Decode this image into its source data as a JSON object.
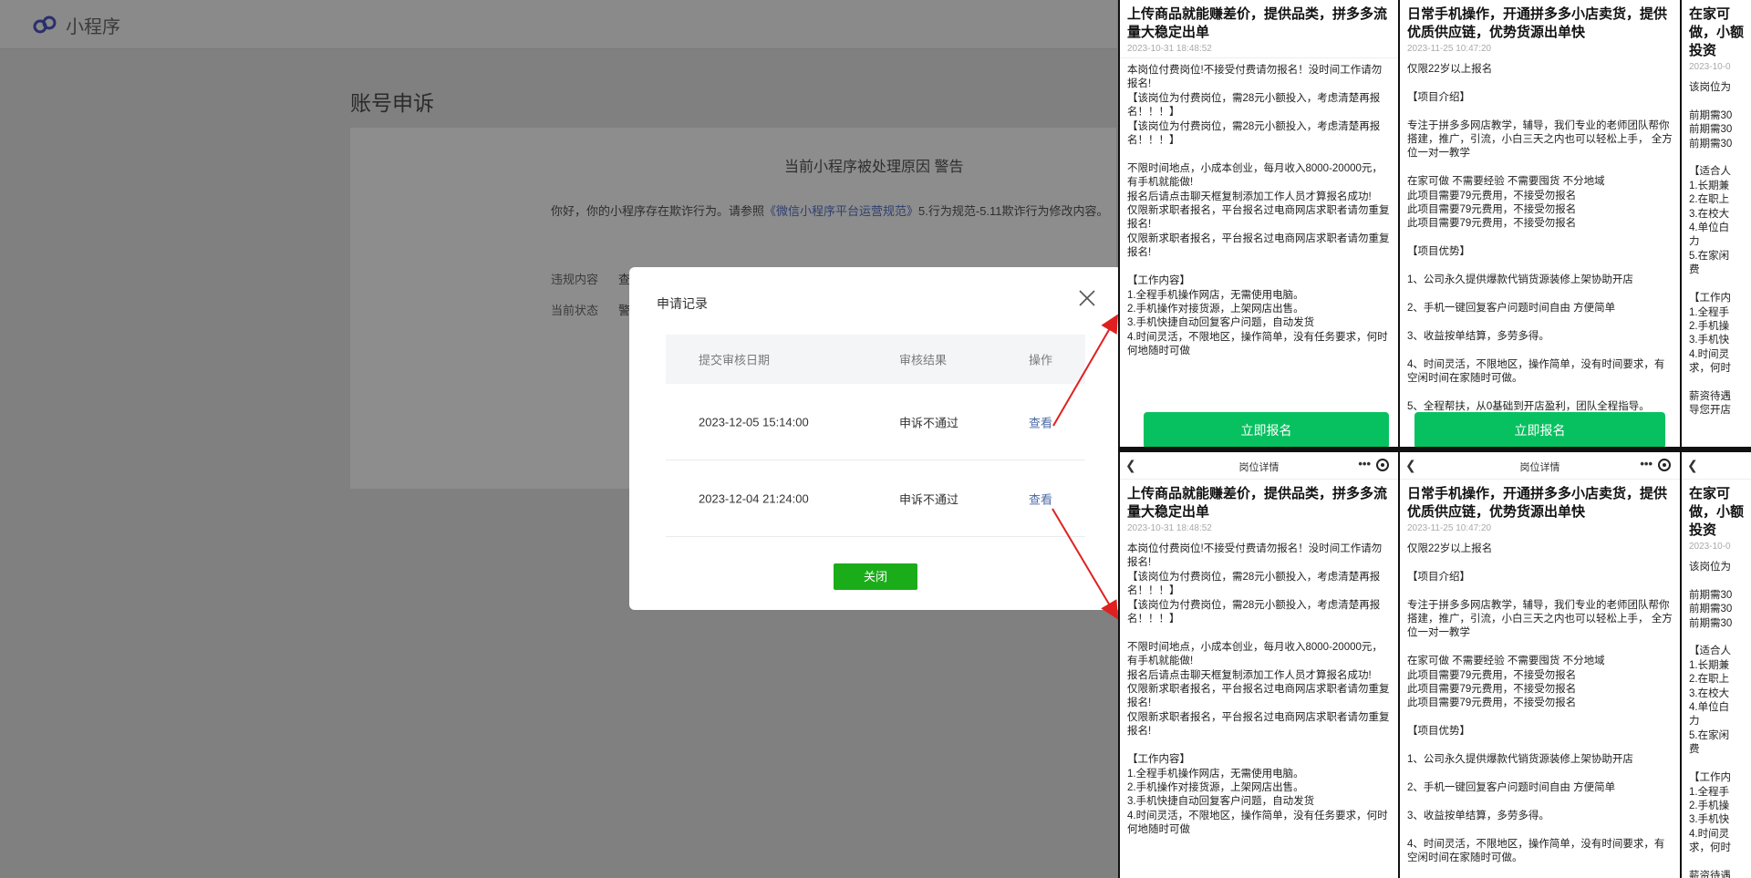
{
  "header": {
    "brand": "小程序"
  },
  "page": {
    "title": "账号申诉",
    "reason_title": "当前小程序被处理原因 警告",
    "reason_pre": "你好，你的小程序存在欺诈行为。请参照",
    "reason_link": "《微信小程序平台运营规范》",
    "reason_post": "5.行为规范-5.11欺诈行为修改内容。",
    "meta": [
      {
        "label": "违规内容",
        "value": "查"
      },
      {
        "label": "当前状态",
        "value": "警"
      }
    ]
  },
  "modal": {
    "title": "申请记录",
    "columns": [
      "提交审核日期",
      "审核结果",
      "操作"
    ],
    "rows": [
      {
        "date": "2023-12-05 15:14:00",
        "result": "申诉不通过",
        "action": "查看"
      },
      {
        "date": "2023-12-04 21:24:00",
        "result": "申诉不通过",
        "action": "查看"
      }
    ],
    "close_label": "关闭"
  },
  "shots": {
    "nav_title": "岗位详情",
    "apply_label": "立即报名",
    "job1": {
      "title": "上传商品就能赚差价，提供品类，拼多多流量大稳定出单",
      "date": "2023-10-31 18:48:52",
      "body": "本岗位付费岗位!不接受付费请勿报名！没时间工作请勿报名!\n【该岗位为付费岗位，需28元小额投入，考虑清楚再报名！！！】\n【该岗位为付费岗位，需28元小额投入，考虑清楚再报名！！！】\n\n不限时间地点，小成本创业，每月收入8000-20000元，有手机就能做!\n报名后请点击聊天框复制添加工作人员才算报名成功!\n仅限新求职者报名，平台报名过电商网店求职者请勿重复报名!\n仅限新求职者报名，平台报名过电商网店求职者请勿重复报名!\n\n【工作内容】\n1.全程手机操作网店，无需使用电脑。\n2.手机操作对接货源，上架网店出售。\n3.手机快捷自动回复客户问题，自动发货\n4.时间灵活，不限地区，操作简单，没有任务要求，何时何地随时可做"
    },
    "job2": {
      "title": "日常手机操作，开通拼多多小店卖货，提供优质供应链，优势货源出单快",
      "date": "2023-11-25 10:47:20",
      "body": "仅限22岁以上报名\n\n【项目介绍】\n\n专注于拼多多网店教学，辅导，我们专业的老师团队帮你搭建，推广，引流，小白三天之内也可以轻松上手， 全方位一对一教学\n\n在家可做 不需要经验 不需要囤货 不分地域\n此项目需要79元费用，不接受勿报名\n此项目需要79元费用，不接受勿报名\n此项目需要79元费用，不接受勿报名\n\n【项目优势】\n\n1、公司永久提供爆款代销货源装修上架协助开店\n\n2、手机一键回复客户问题时间自由 方便简单\n\n3、收益按单结算，多劳多得。\n\n4、时间灵活，不限地区，操作简单，没有时间要求，有空闲时间在家随时可做。\n\n5、全程帮扶，从0基础到开店盈利，团队全程指导。"
    },
    "job3": {
      "title": "在家可做，小额投资",
      "date": "2023-10-0",
      "body": "该岗位为\n\n前期需30\n前期需30\n前期需30\n\n【适合人\n1.长期兼\n2.在职上\n3.在校大\n4.单位白\n力\n5.在家闲\n费\n\n【工作内\n1.全程手\n2.手机操\n3.手机快\n4.时间灵\n求，何时\n\n薪资待遇\n导您开店"
    }
  }
}
